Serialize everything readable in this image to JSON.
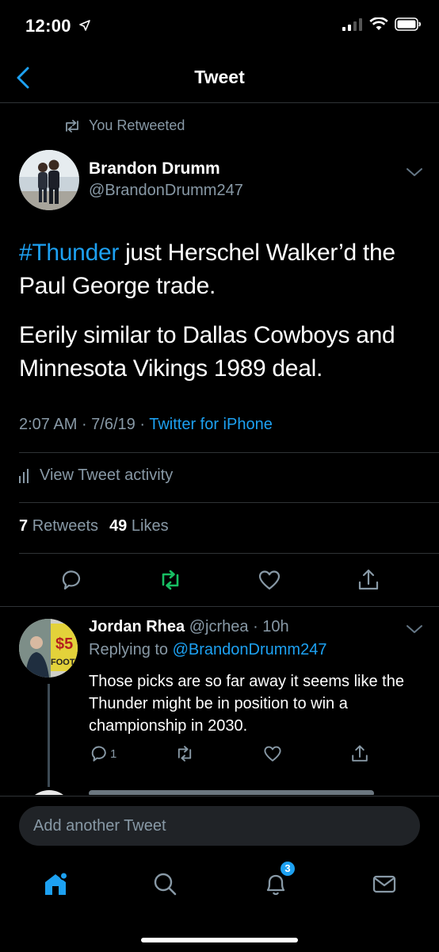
{
  "status_bar": {
    "time": "12:00"
  },
  "nav": {
    "title": "Tweet"
  },
  "retweet_note": "You Retweeted",
  "tweet": {
    "author_name": "Brandon Drumm",
    "author_handle": "@BrandonDrumm247",
    "hashtag": "#Thunder",
    "line1_rest": " just Herschel Walker’d the",
    "line2": "Paul George trade.",
    "para2_line1": "Eerily similar to Dallas Cowboys and",
    "para2_line2": "Minnesota Vikings 1989 deal.",
    "time": "2:07 AM",
    "sep": " · ",
    "date": "7/6/19",
    "source": "Twitter for iPhone",
    "activity_label": "View Tweet activity",
    "retweet_count": "7",
    "retweets_label": "Retweets",
    "like_count": "49",
    "likes_label": "Likes"
  },
  "reply": {
    "name": "Jordan Rhea",
    "handle": "@jcrhea",
    "age": "· 10h",
    "replying_label": "Replying to",
    "replying_handle": "@BrandonDrumm247",
    "text": "Those picks are so far away it seems like the Thunder might be in position to win a championship in 2030.",
    "reply_count": "1"
  },
  "composer": {
    "placeholder": "Add another Tweet"
  },
  "tabs": {
    "notifications_badge": "3"
  },
  "colors": {
    "accent": "#1da1f2",
    "retweet_green": "#17bf63",
    "muted": "#8899a6",
    "background": "#000000"
  }
}
